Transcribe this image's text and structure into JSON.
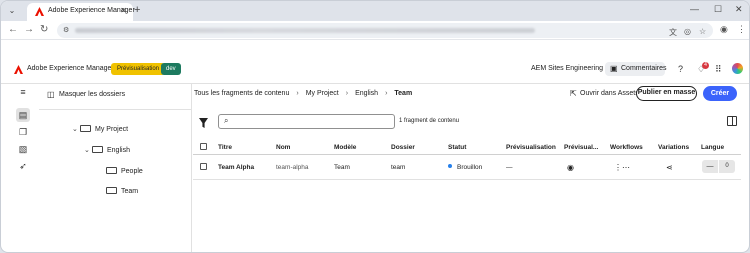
{
  "browser": {
    "tab_title": "Adobe Experience Manager",
    "tab_close": "✕",
    "new_tab": "+",
    "window_controls": [
      "—",
      "☐",
      "✕"
    ]
  },
  "aem": {
    "product_title": "Adobe Experience Manager",
    "badge_preview": "Prévisualisation",
    "badge_env": "dev",
    "product_name": "AEM Sites Engineering",
    "comments_label": "Commentaires",
    "notification_count": "4"
  },
  "folders": {
    "hide_label": "Masquer les dossiers",
    "tree": [
      {
        "label": "My Project"
      },
      {
        "label": "English"
      },
      {
        "label": "People"
      },
      {
        "label": "Team"
      }
    ]
  },
  "main": {
    "breadcrumb": [
      "Tous les fragments de contenu",
      "My Project",
      "English",
      "Team"
    ],
    "open_assets": "Ouvrir dans Assets",
    "publish_button": "Publier en masse",
    "create_button": "Créer",
    "search_placeholder": "",
    "count_text": "1 fragment de contenu",
    "columns": [
      "Titre",
      "Nom",
      "Modèle",
      "Dossier",
      "Statut",
      "Prévisualisation",
      "Prévisual...",
      "Workflows",
      "Variations",
      "Langue"
    ],
    "rows": [
      {
        "title": "Team Alpha",
        "name": "team-alpha",
        "model": "Team",
        "folder": "team",
        "status": "Brouillon",
        "preview": "—",
        "lang_dash": "—",
        "lang_count": "0"
      }
    ]
  },
  "colors": {
    "accent": "#3b63fb",
    "brand": "#eb1000",
    "preview_badge": "#f0c200",
    "env_badge": "#1d7a5f",
    "status_draft": "#2680eb"
  }
}
